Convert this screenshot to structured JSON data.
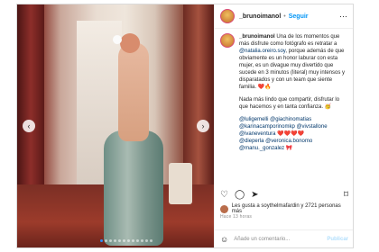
{
  "post": {
    "username": "_brunoimanol",
    "separator": "•",
    "follow_label": "Seguir",
    "more_icon": "more-horizontal-icon",
    "caption_intro": "Una de los momentos que más disfrute como fotógrafo es retratar a ",
    "caption_mention": "@natalia.oreiro.soy",
    "caption_rest": ", porque además de que obviamente es un honor laburar con esta mujer, es un divague muy divertido que sucede en 3 minutos (literal) muy intensos y disparatados y con un team que siente familia. ",
    "caption_emoji": "❤️🔥",
    "para2": "Nada más lindo que compartir, disfrutar lo que hacemos y en tanta confianza. 🥳",
    "tags": [
      "@luligemelli @giachinomatias",
      "@karinacamporinomkp @vivstallone",
      "@ivaneventura ❤️❤️❤️❤️",
      "@dieperla @veronica.bonomo",
      "@manu._gonzalez 🎀"
    ],
    "likes_text": "Les gusta a soythelmafardin y 2721 personas más",
    "date": "Hace 13 horas",
    "comment_placeholder": "Añade un comentario...",
    "publish_label": "Publicar"
  },
  "icons": {
    "like": "heart-icon",
    "comment": "comment-icon",
    "share": "share-icon",
    "save": "bookmark-icon",
    "emoji": "smiley-icon",
    "nav_left": "chevron-left-icon",
    "nav_right": "chevron-right-icon"
  },
  "carousel": {
    "total": 12,
    "active_index": 0
  }
}
